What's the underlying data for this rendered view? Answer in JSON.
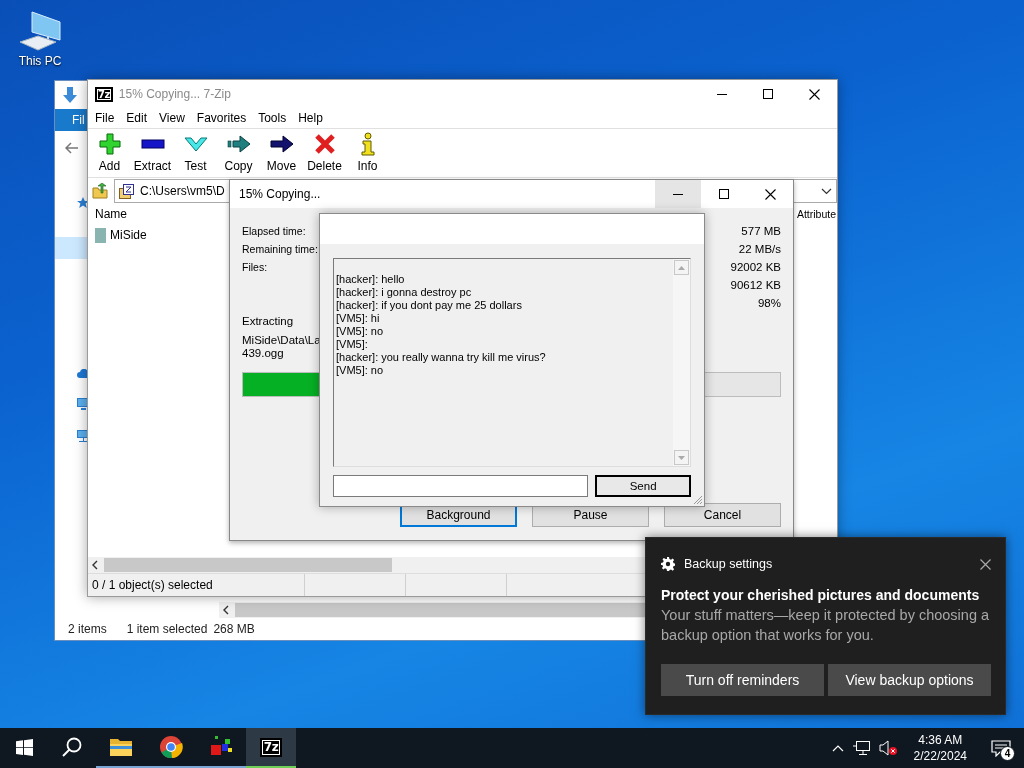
{
  "desktop_icons": [
    {
      "label": "This PC"
    }
  ],
  "explorer": {
    "ribbon_tab": "Fil",
    "nav_rows": [
      {
        "selected": true
      }
    ],
    "status": [
      "2 items",
      "1 item selected",
      "268 MB"
    ]
  },
  "archive_window": {
    "title": "15% Copying... 7-Zip",
    "logo": "7z",
    "active": false,
    "menu": [
      "File",
      "Edit",
      "View",
      "Favorites",
      "Tools",
      "Help"
    ],
    "toolbar": [
      {
        "kind": "add",
        "label": "Add"
      },
      {
        "kind": "extract",
        "label": "Extract"
      },
      {
        "kind": "test",
        "label": "Test"
      },
      {
        "kind": "copy",
        "label": "Copy"
      },
      {
        "kind": "move",
        "label": "Move"
      },
      {
        "kind": "delete",
        "label": "Delete"
      },
      {
        "kind": "info",
        "label": "Info"
      }
    ],
    "address": "C:\\Users\\vm5\\D",
    "columns": [
      "Name",
      "Attribute"
    ],
    "rows": [
      {
        "name": "MiSide"
      }
    ],
    "status": "0 / 1 object(s) selected"
  },
  "progress_dialog": {
    "title": "15% Copying...",
    "active": true,
    "stats": [
      {
        "label": "Elapsed time:",
        "value": "577 MB"
      },
      {
        "label": "Remaining time:",
        "value": "22 MB/s"
      },
      {
        "label": "Files:",
        "value": "92002 KB"
      },
      {
        "value": "90612 KB"
      },
      {
        "value": "98%"
      }
    ],
    "operation": "Extracting",
    "path_lines": [
      "MiSide\\Data\\La",
      "439.ogg"
    ],
    "level": 0.15,
    "buttons": [
      {
        "label": "Background",
        "focused": true
      },
      {
        "label": "Pause",
        "focused": false
      },
      {
        "label": "Cancel",
        "focused": false
      }
    ]
  },
  "chat_window": {
    "messages": [
      "[hacker]: hello",
      "[hacker]: i gonna destroy pc",
      "[hacker]: if you dont pay me 25 dollars",
      "[VM5]: hi",
      "[VM5]: no",
      "[VM5]:",
      "[hacker]: you really wanna try kill me virus?",
      "[VM5]: no"
    ],
    "send_button": "Send"
  },
  "notification": {
    "app": "Backup settings",
    "title": "Protect your cherished pictures and documents",
    "body": "Your stuff matters—keep it protected by choosing a backup option that works for you.",
    "buttons": [
      "Turn off reminders",
      "View backup options"
    ]
  },
  "taskbar": {
    "apps": [
      {
        "kind": "start",
        "running": false,
        "selected": false
      },
      {
        "kind": "search",
        "running": false,
        "selected": false
      },
      {
        "kind": "folder",
        "running": true,
        "selected": false
      },
      {
        "kind": "browser",
        "running": true,
        "selected": false
      },
      {
        "kind": "blocks",
        "running": true,
        "selected": false
      },
      {
        "kind": "archiver",
        "running": true,
        "selected": true,
        "logo": "7z"
      }
    ],
    "time": "4:36 AM",
    "date": "2/22/2024",
    "notification_count": "4"
  }
}
